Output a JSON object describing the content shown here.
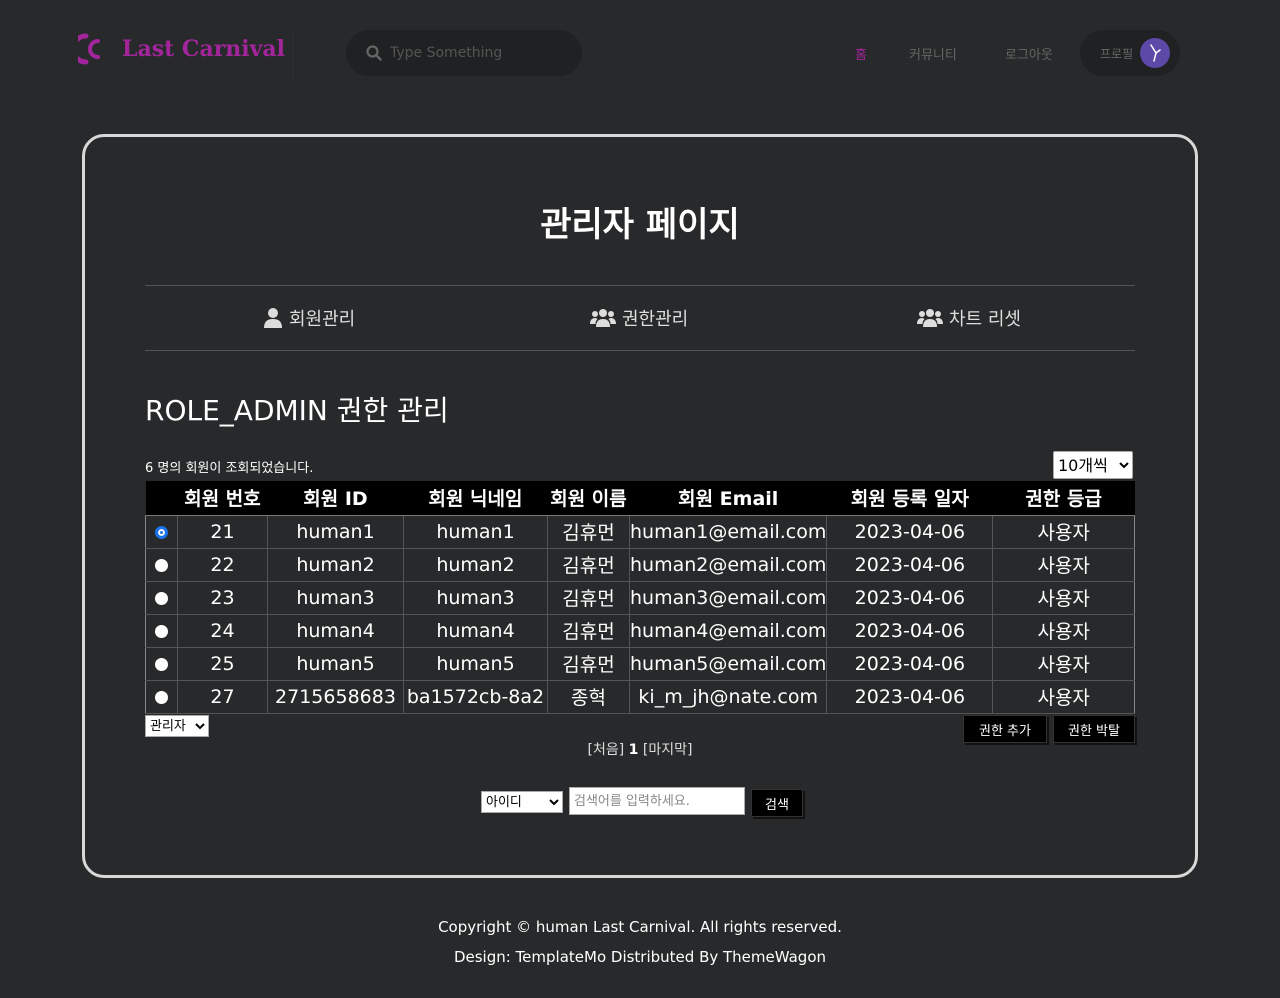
{
  "header": {
    "logo_text": "Last Carnival",
    "search_placeholder": "Type Something",
    "nav": {
      "home": "홈",
      "community": "커뮤니티",
      "logout": "로그아웃",
      "profile": "프로필"
    }
  },
  "main": {
    "page_title": "관리자 페이지",
    "tabs": [
      {
        "label": "회원관리",
        "icon": "user-icon"
      },
      {
        "label": "권한관리",
        "icon": "users-icon"
      },
      {
        "label": "차트 리셋",
        "icon": "users-icon"
      }
    ],
    "section_title": "ROLE_ADMIN 권한 관리",
    "count_text": "6 명의 회원이 조회되었습니다.",
    "page_size": "10개씩",
    "table": {
      "headers": [
        "",
        "회원 번호",
        "회원 ID",
        "회원 닉네임",
        "회원 이름",
        "회원 Email",
        "회원 등록 일자",
        "권한 등급"
      ],
      "rows": [
        {
          "no": "21",
          "id": "human1",
          "nickname": "human1",
          "name": "김휴먼",
          "email": "human1@email.com",
          "date": "2023-04-06",
          "grade": "사용자",
          "checked": true
        },
        {
          "no": "22",
          "id": "human2",
          "nickname": "human2",
          "name": "김휴먼",
          "email": "human2@email.com",
          "date": "2023-04-06",
          "grade": "사용자",
          "checked": false
        },
        {
          "no": "23",
          "id": "human3",
          "nickname": "human3",
          "name": "김휴먼",
          "email": "human3@email.com",
          "date": "2023-04-06",
          "grade": "사용자",
          "checked": false
        },
        {
          "no": "24",
          "id": "human4",
          "nickname": "human4",
          "name": "김휴먼",
          "email": "human4@email.com",
          "date": "2023-04-06",
          "grade": "사용자",
          "checked": false
        },
        {
          "no": "25",
          "id": "human5",
          "nickname": "human5",
          "name": "김휴먼",
          "email": "human5@email.com",
          "date": "2023-04-06",
          "grade": "사용자",
          "checked": false
        },
        {
          "no": "27",
          "id": "2715658683",
          "nickname": "ba1572cb-8a2",
          "name": "종혁",
          "email": "ki_m_jh@nate.com",
          "date": "2023-04-06",
          "grade": "사용자",
          "checked": false
        }
      ]
    },
    "role_select": "관리자",
    "add_role_button": "권한 추가",
    "remove_role_button": "권한 박탈",
    "pager": {
      "first": "[처음]",
      "current": "1",
      "last": "[마지막]"
    },
    "search": {
      "type": "아이디",
      "placeholder": "검색어를 입력하세요.",
      "button": "검색"
    }
  },
  "footer": {
    "copyright": "Copyright © human Last Carnival. All rights reserved.",
    "design": "Design: TemplateMo Distributed By ThemeWagon"
  },
  "colors": {
    "background": "#27292a",
    "accent": "#a3259c",
    "panel_border": "#d8d8d8"
  }
}
